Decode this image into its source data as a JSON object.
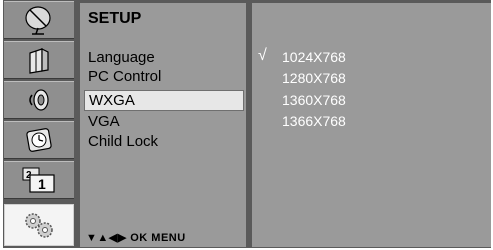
{
  "menu": {
    "title": "SETUP",
    "items": [
      {
        "label": "Language"
      },
      {
        "label": "PC Control"
      },
      {
        "label": "WXGA",
        "selected": true
      },
      {
        "label": "VGA"
      },
      {
        "label": "Child Lock"
      }
    ],
    "footer": "▼▲◀▶ OK MENU"
  },
  "submenu": {
    "check_mark": "√",
    "options": [
      "1024X768",
      "1280X768",
      "1360X768",
      "1366X768"
    ],
    "checked_option": "1024X768"
  },
  "sidebar": {
    "icons": [
      "satellite-dish-icon",
      "picture-icon",
      "sound-icon",
      "clock-icon",
      "channel-icon",
      "setup-gears-icon"
    ],
    "active": "setup-gears-icon",
    "channel_icon_text": {
      "small": "2",
      "large": "1"
    }
  },
  "colors": {
    "frame": "#5a5a5a",
    "panel": "#9a9a9a",
    "highlight": "#e7e7e7",
    "option_text": "#ffffff"
  }
}
